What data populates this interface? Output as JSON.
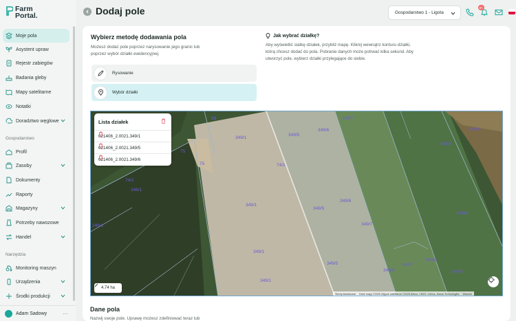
{
  "app": {
    "logo_line1": "Farm",
    "logo_line2": "Portal."
  },
  "sidebar": {
    "items": [
      {
        "label": "Moje pola",
        "icon": "field-icon",
        "active": true
      },
      {
        "label": "Asystent upraw",
        "icon": "sprout-icon"
      },
      {
        "label": "Rejestr zabiegów",
        "icon": "register-icon"
      },
      {
        "label": "Badania gleby",
        "icon": "soil-icon"
      },
      {
        "label": "Mapy satelitarne",
        "icon": "satellite-icon"
      },
      {
        "label": "Notatki",
        "icon": "notes-icon"
      },
      {
        "label": "Doradztwo węglowe",
        "icon": "carbon-icon",
        "chevron": true
      }
    ],
    "section_farm": "Gospodarstwo",
    "farm_items": [
      {
        "label": "Profil",
        "icon": "profile-icon"
      },
      {
        "label": "Zasoby",
        "icon": "resources-icon",
        "chevron": true
      },
      {
        "label": "Dokumenty",
        "icon": "documents-icon"
      },
      {
        "label": "Raporty",
        "icon": "reports-icon"
      },
      {
        "label": "Magazyny",
        "icon": "warehouse-icon",
        "chevron": true
      },
      {
        "label": "Potrzeby nawozowe",
        "icon": "fertilizer-icon"
      },
      {
        "label": "Handel",
        "icon": "trade-icon",
        "chevron": true
      }
    ],
    "section_tools": "Narzędzia",
    "tool_items": [
      {
        "label": "Monitoring maszyn",
        "icon": "machine-icon"
      },
      {
        "label": "Urządzenia",
        "icon": "devices-icon",
        "chevron": true
      },
      {
        "label": "Środki produkcji",
        "icon": "production-icon",
        "chevron": true
      }
    ],
    "user_name": "Adam Sadowy"
  },
  "header": {
    "title": "Dodaj pole",
    "farm_select": "Gospodarstwo 1 - Ligota",
    "notifications_count": "9+"
  },
  "method": {
    "title": "Wybierz metodę dodawania pola",
    "description": "Możesz dodać pole poprzez narysowanie jego granic lub poprzez wybór działki ewidencyjnej.",
    "options": [
      {
        "label": "Rysowanie",
        "icon": "pencil-icon",
        "selected": false
      },
      {
        "label": "Wybór działki",
        "icon": "location-pin-icon",
        "selected": true
      }
    ],
    "help_title": "Jak wybrać działkę?",
    "help_text": "Aby wyświetlić siatkę działek, przybliż mapę. Kliknij wewnątrz konturu działki, którą chcesz dodać do pola. Pobranie danych może potrwać kilka sekund. Aby utworzyć pole, wybierz działki przylegające do siebie."
  },
  "parcels": {
    "title": "Lista działek",
    "items": [
      "021406_2.0021.349/1",
      "021406_2.0021.349/5",
      "021406_2.0021.349/6"
    ]
  },
  "map": {
    "area": "4.74 ha",
    "attribution": [
      "Skróty klawiszowe",
      "Dane mapy ©2025 Zdjęcie satelitarne ©2025 Airbus, CNES / Airbus, Maxar Technologies",
      "Warunki"
    ],
    "labels": [
      "349/1",
      "349/5",
      "349/6",
      "349/7",
      "349/9",
      "349/8",
      "74/1",
      "246/1",
      "246/1",
      "349/1",
      "349/5",
      "349/6",
      "349/7",
      "349/1",
      "349/5",
      "349/6",
      "349/7",
      "349/8",
      "349/1",
      "349/8",
      "349/9",
      "74/1",
      "75",
      "75",
      "56"
    ]
  },
  "details": {
    "title": "Dane pola",
    "subtitle": "Nazwij swoje pole. Uprawę możesz zdefiniować teraz lub"
  }
}
